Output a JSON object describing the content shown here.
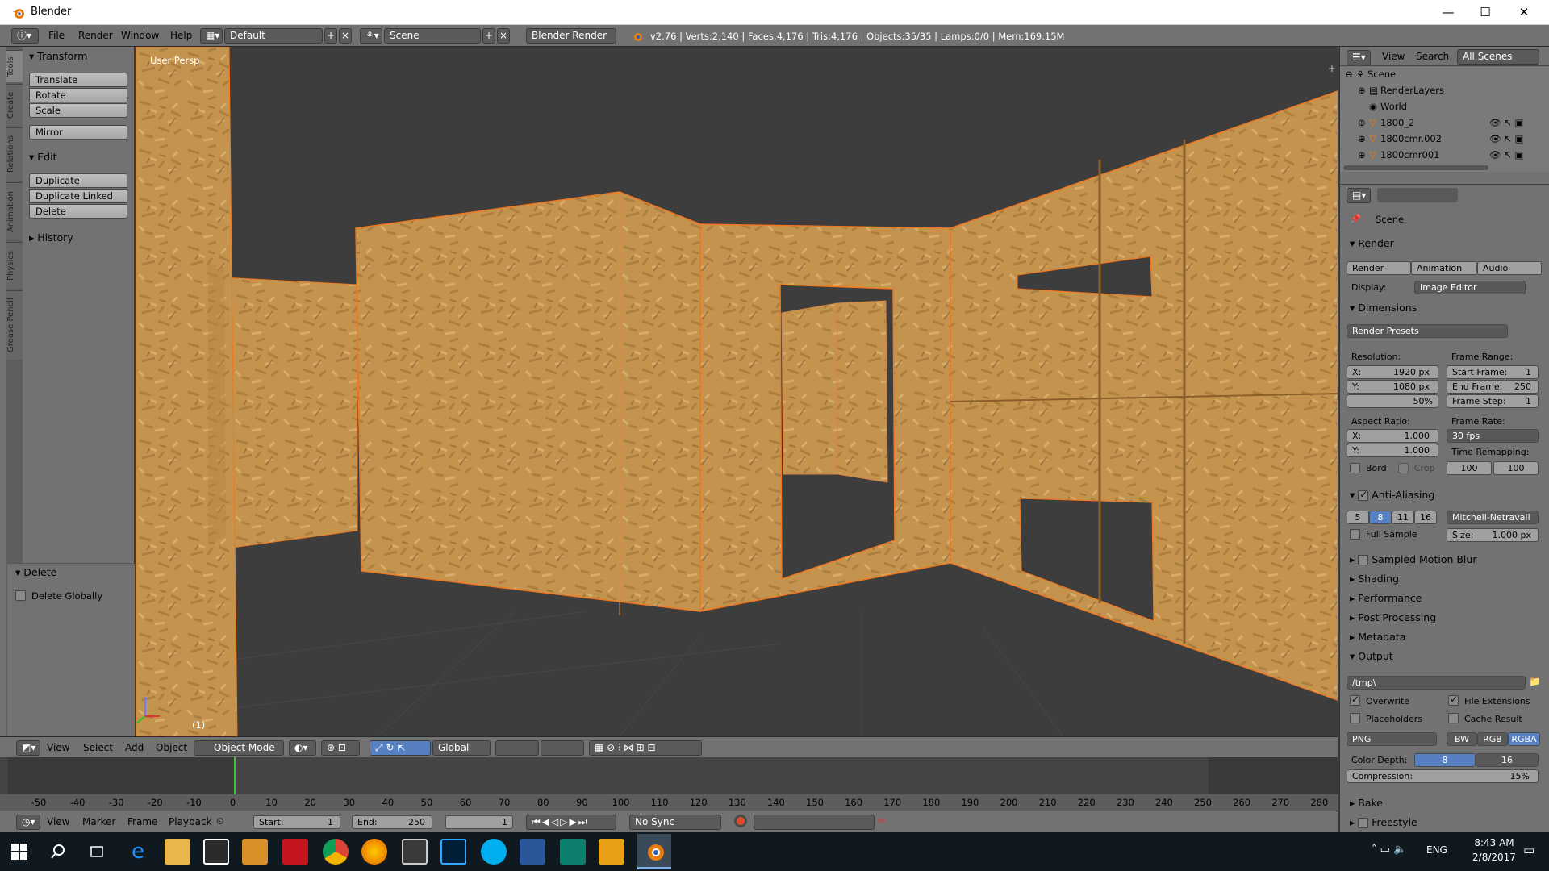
{
  "window": {
    "title": "Blender",
    "minimize": "—",
    "maximize": "☐",
    "close": "✕"
  },
  "infobar": {
    "menus": [
      "File",
      "Render",
      "Window",
      "Help"
    ],
    "layout": "Default",
    "scene": "Scene",
    "engine": "Blender Render",
    "stats": "v2.76 | Verts:2,140 | Faces:4,176 | Tris:4,176 | Objects:35/35 | Lamps:0/0 | Mem:169.15M"
  },
  "tool_shelf": {
    "tabs": [
      "Tools",
      "Create",
      "Relations",
      "Animation",
      "Physics",
      "Grease Pencil"
    ],
    "transform": {
      "title": "Transform",
      "buttons": [
        "Translate",
        "Rotate",
        "Scale",
        "Mirror"
      ]
    },
    "edit": {
      "title": "Edit",
      "buttons": [
        "Duplicate",
        "Duplicate Linked",
        "Delete"
      ]
    },
    "history": {
      "title": "History"
    },
    "delete_panel": {
      "title": "Delete",
      "option": "Delete Globally"
    }
  },
  "viewport": {
    "label": "User Persp",
    "frame": "(1)"
  },
  "outliner": {
    "menus": [
      "View",
      "Search"
    ],
    "filter": "All Scenes",
    "items": [
      "Scene",
      "RenderLayers",
      "World",
      "1800_2",
      "1800cmr.002",
      "1800cmr001"
    ]
  },
  "properties": {
    "context": "Scene",
    "render": {
      "title": "Render",
      "buttons": [
        "Render",
        "Animation",
        "Audio"
      ],
      "display_label": "Display:",
      "display_value": "Image Editor"
    },
    "dimensions": {
      "title": "Dimensions",
      "presets": "Render Presets",
      "resolution_label": "Resolution:",
      "res_x": "1920 px",
      "res_y": "1080 px",
      "res_pct": "50%",
      "frame_range_label": "Frame Range:",
      "start_frame": "1",
      "end_frame": "250",
      "frame_step": "1",
      "aspect_label": "Aspect Ratio:",
      "aspect_x": "1.000",
      "aspect_y": "1.000",
      "frame_rate_label": "Frame Rate:",
      "frame_rate": "30 fps",
      "time_remap_label": "Time Remapping:",
      "remap_old": "100",
      "remap_new": "100",
      "border": "Bord",
      "crop": "Crop",
      "x_label": "X:",
      "y_label": "Y:",
      "start_label": "Start Frame:",
      "end_label": "End Frame:",
      "step_label": "Frame Step:"
    },
    "anti_aliasing": {
      "title": "Anti-Aliasing",
      "samples": [
        "5",
        "8",
        "11",
        "16"
      ],
      "selected_sample": "8",
      "filter": "Mitchell-Netravali",
      "full_sample": "Full Sample",
      "size_label": "Size:",
      "size": "1.000 px"
    },
    "collapsed_panels": [
      "Sampled Motion Blur",
      "Shading",
      "Performance",
      "Post Processing",
      "Metadata"
    ],
    "output": {
      "title": "Output",
      "path": "/tmp\\",
      "overwrite": "Overwrite",
      "file_extensions": "File Extensions",
      "placeholders": "Placeholders",
      "cache_result": "Cache Result",
      "format": "PNG",
      "color_modes": [
        "BW",
        "RGB",
        "RGBA"
      ],
      "selected_mode": "RGBA",
      "color_depth_label": "Color Depth:",
      "depths": [
        "8",
        "16"
      ],
      "compression_label": "Compression:",
      "compression": "15%"
    },
    "bottom_panels": [
      "Bake",
      "Freestyle"
    ]
  },
  "viewport_header": {
    "menus": [
      "View",
      "Select",
      "Add",
      "Object"
    ],
    "mode": "Object Mode",
    "orientation": "Global"
  },
  "timeline": {
    "ticks": [
      "-50",
      "-40",
      "-30",
      "-20",
      "-10",
      "0",
      "10",
      "20",
      "30",
      "40",
      "50",
      "60",
      "70",
      "80",
      "90",
      "100",
      "110",
      "120",
      "130",
      "140",
      "150",
      "160",
      "170",
      "180",
      "190",
      "200",
      "210",
      "220",
      "230",
      "240",
      "250",
      "260",
      "270",
      "280"
    ],
    "current_frame_value": 1,
    "menus": [
      "View",
      "Marker",
      "Frame",
      "Playback"
    ],
    "start_label": "Start:",
    "start": "1",
    "end_label": "End:",
    "end": "250",
    "current": "1",
    "sync": "No Sync"
  },
  "taskbar": {
    "time": "8:43 AM",
    "date": "2/8/2017",
    "lang": "ENG"
  },
  "colors": {
    "accent": "#5680c2",
    "wood": "#c4944f",
    "selection_outline": "#f07820"
  }
}
